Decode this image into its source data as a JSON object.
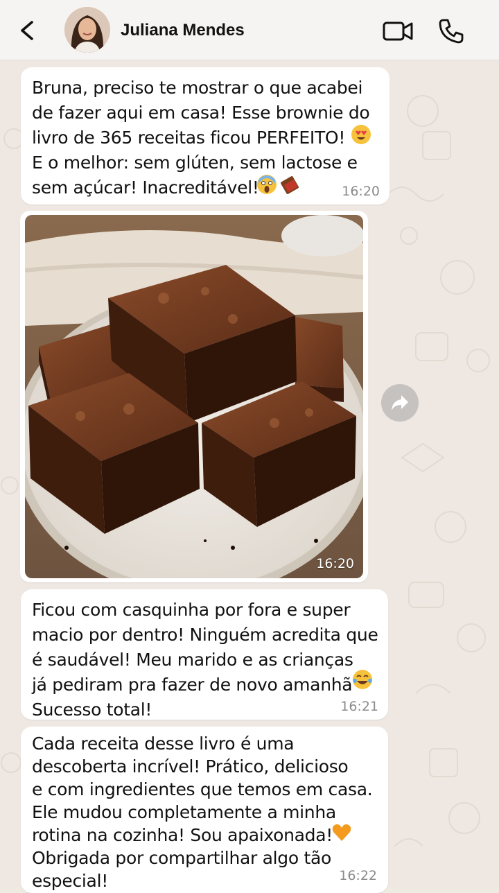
{
  "header": {
    "contact_name": "Juliana Mendes",
    "back_icon": "back-arrow-icon",
    "video_icon": "video-camera-icon",
    "call_icon": "phone-icon"
  },
  "messages": [
    {
      "text": "Bruna, preciso te mostrar o que acabei\nde fazer aqui em casa! Esse brownie do\nlivro de 365 receitas ficou PERFEITO! \nE o melhor: sem glúten, sem lactose e\nsem açúcar! Inacreditável! ",
      "time": "16:20",
      "emojis": [
        "heart-eyes-emoji",
        "screaming-face-emoji",
        "chocolate-bar-emoji"
      ]
    },
    {
      "type": "image",
      "alt_icon": "brownie-photo",
      "time": "16:20"
    },
    {
      "text": "Ficou com casquinha por fora e super\nmacio por dentro! Ninguém acredita que\né saudável! Meu marido e as crianças\njá pediram pra fazer de novo amanhã \nSucesso total!",
      "time": "16:21",
      "emojis": [
        "tears-of-joy-emoji"
      ]
    },
    {
      "text": "Cada receita desse livro é uma\ndescoberta incrível! Prático, delicioso\ne com ingredientes que temos em casa.\nEle mudou completamente a minha\nrotina na cozinha! Sou apaixonada! \nObrigada por compartilhar algo tão\nespecial!",
      "time": "16:22",
      "emojis": [
        "orange-heart-emoji"
      ]
    }
  ],
  "forward_icon": "forward-arrow-icon",
  "colors": {
    "header_bg": "#f6f4f2",
    "chat_bg": "#efe8e2",
    "bubble_bg": "#ffffff",
    "time_gray": "#8b8b8b"
  }
}
